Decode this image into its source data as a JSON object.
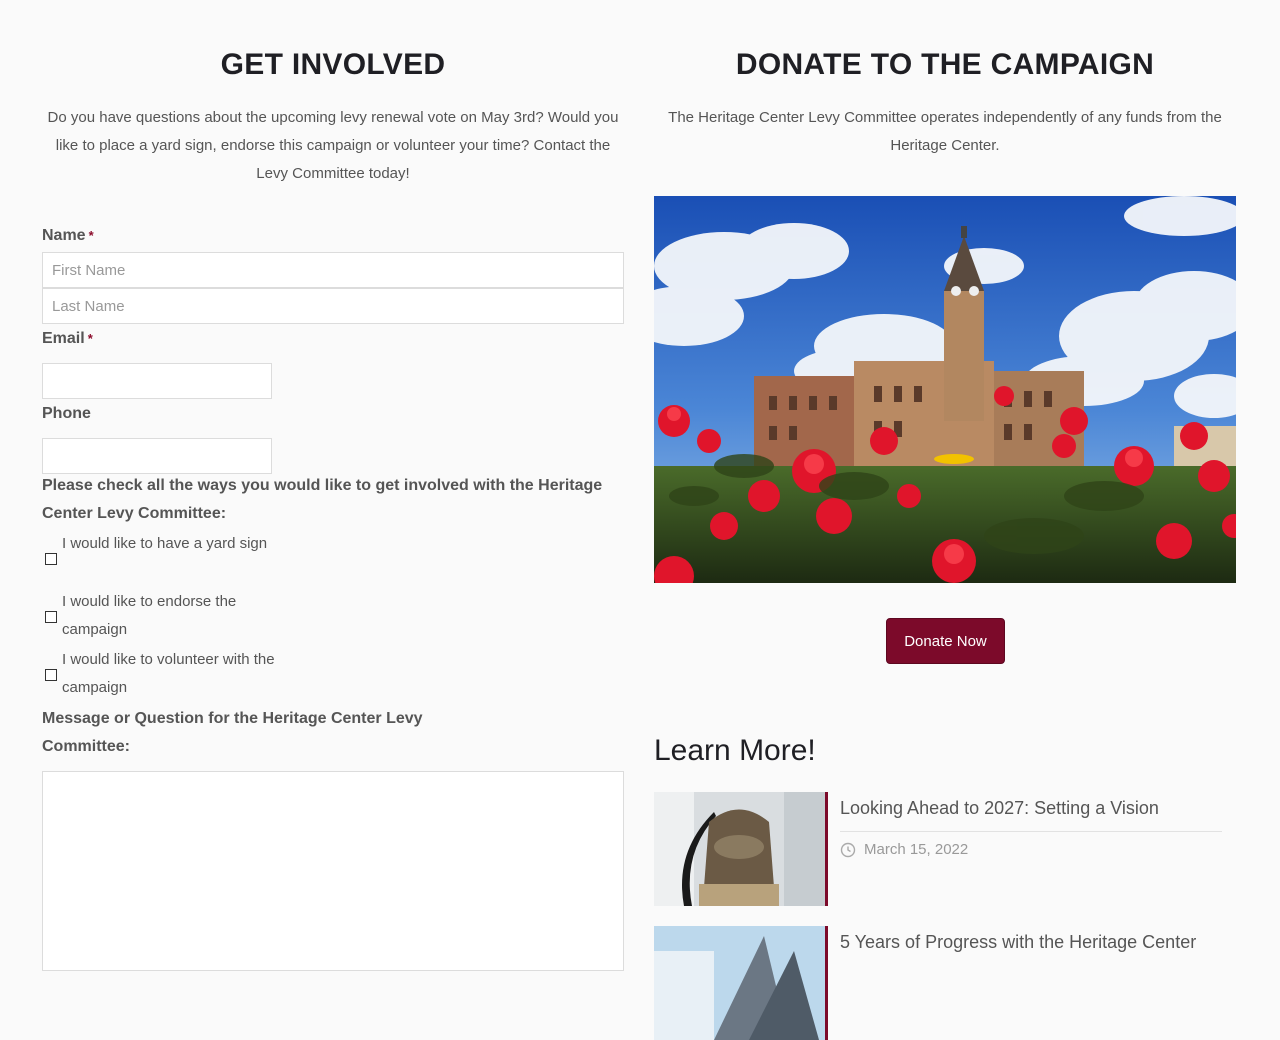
{
  "get_involved": {
    "title": "GET INVOLVED",
    "intro": "Do you have questions about the upcoming levy renewal vote on May 3rd? Would you like to place a yard sign, endorse this campaign or volunteer your time? Contact the Levy Committee today!",
    "form": {
      "name_label": "Name",
      "required_mark": "*",
      "first_name_placeholder": "First Name",
      "last_name_placeholder": "Last Name",
      "email_label": "Email",
      "phone_label": "Phone",
      "involvement_label": "Please check all the ways you would like to get involved with the Heritage Center Levy Committee:",
      "options": [
        {
          "label": "I would like to have a yard sign",
          "checked": false
        },
        {
          "label": "I would like to endorse the campaign",
          "checked": false
        },
        {
          "label": "I would like to volunteer with the campaign",
          "checked": false
        }
      ],
      "message_label": "Message or Question for the Heritage Center Levy Committee:"
    }
  },
  "donate": {
    "title": "DONATE TO THE CAMPAIGN",
    "intro": "The Heritage Center Levy Committee operates independently of any funds from the Heritage Center.",
    "photo_icon": "courthouse-roses-photo",
    "button_label": "Donate Now"
  },
  "learn_more": {
    "title": "Learn More!",
    "posts": [
      {
        "title": "Looking Ahead to 2027: Setting a Vision",
        "date": "March 15, 2022",
        "thumb_icon": "ohio-bell-photo"
      },
      {
        "title": "5 Years of Progress with the Heritage Center",
        "date": "",
        "thumb_icon": "building-photo"
      }
    ]
  },
  "colors": {
    "accent": "#7c0a2a",
    "heading": "#1f1f24",
    "text": "#555555",
    "background": "#fafafa"
  }
}
